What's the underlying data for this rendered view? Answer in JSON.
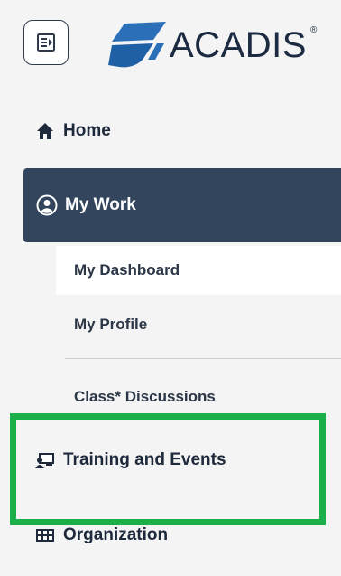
{
  "brand": {
    "name": "ACADIS",
    "registered": "®"
  },
  "colors": {
    "active_bg": "#33455d",
    "highlight": "#1aaf48",
    "text": "#1e2a3c"
  },
  "nav": {
    "home": {
      "label": "Home",
      "icon": "home-icon"
    },
    "my_work": {
      "label": "My Work",
      "icon": "user-circle-icon",
      "items": [
        {
          "label": "My Dashboard",
          "active": true
        },
        {
          "label": "My Profile"
        },
        {
          "label": "Class* Discussions"
        }
      ]
    },
    "training": {
      "label": "Training and Events",
      "icon": "training-icon"
    },
    "organization": {
      "label": "Organization",
      "icon": "organization-icon"
    }
  }
}
